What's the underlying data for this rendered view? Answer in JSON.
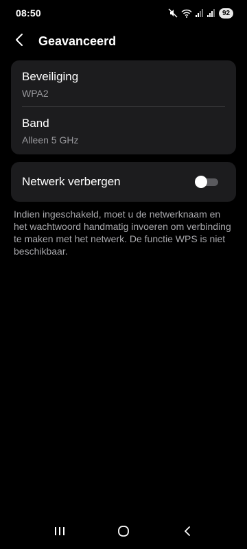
{
  "status_bar": {
    "time": "08:50",
    "battery": "92",
    "icons": [
      "mute-icon",
      "wifi-icon",
      "signal-icon",
      "signal-icon"
    ]
  },
  "header": {
    "back_icon": "back-arrow-icon",
    "title": "Geavanceerd"
  },
  "settings": {
    "security": {
      "title": "Beveiliging",
      "value": "WPA2"
    },
    "band": {
      "title": "Band",
      "value": "Alleen 5 GHz"
    },
    "hide_network": {
      "label": "Netwerk verbergen",
      "enabled": false
    }
  },
  "description": "Indien ingeschakeld, moet u de netwerknaam en het wachtwoord handmatig invoeren om verbinding te maken met het netwerk. De functie WPS is niet beschikbaar.",
  "nav_bar": {
    "icons": [
      "recent-apps-icon",
      "home-icon",
      "back-icon"
    ]
  },
  "colors": {
    "background": "#000000",
    "card": "#1c1c1e",
    "secondary_text": "#9a9a9e",
    "toggle_track_off": "#5a5a5e"
  }
}
